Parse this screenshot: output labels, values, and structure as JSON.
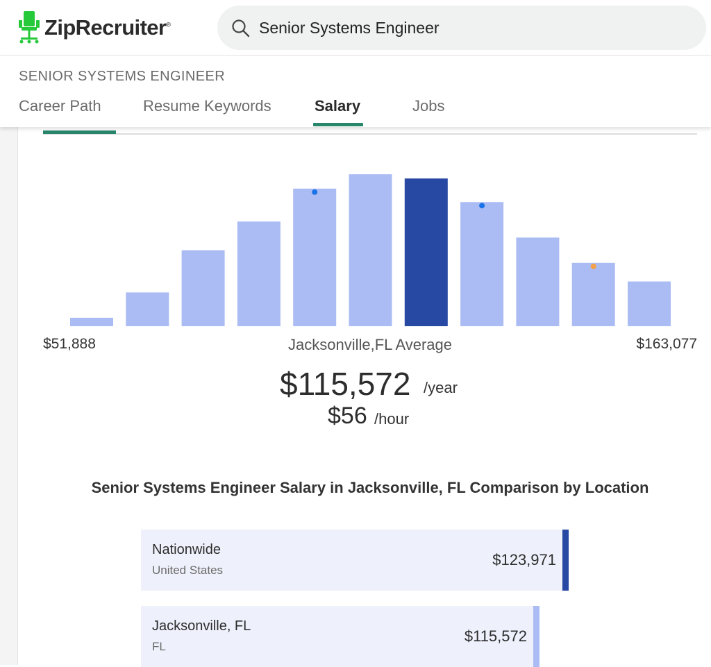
{
  "brand": {
    "name": "ZipRecruiter",
    "mark": "®",
    "chair_color": "#25c93a"
  },
  "search": {
    "value": "Senior Systems Engineer"
  },
  "breadcrumb": "SENIOR SYSTEMS ENGINEER",
  "tabs": [
    {
      "label": "Career Path",
      "active": false
    },
    {
      "label": "Resume Keywords",
      "active": false
    },
    {
      "label": "Salary",
      "active": true
    },
    {
      "label": "Jobs",
      "active": false
    }
  ],
  "colors": {
    "accent": "#28866b",
    "bar": "#aabcf3",
    "bar_highlight": "#2748a3",
    "marker_blue": "#1a73e8",
    "marker_orange": "#f4a14a"
  },
  "chart_data": {
    "type": "bar",
    "bins": 11,
    "values": [
      1,
      4,
      9,
      12.4,
      16.3,
      18,
      17.5,
      14.7,
      10.5,
      7.5,
      5.3
    ],
    "highlight_index": 6,
    "markers": [
      {
        "index": 4,
        "color": "#1a73e8"
      },
      {
        "index": 7,
        "color": "#1a73e8"
      },
      {
        "index": 9,
        "color": "#f4a14a"
      }
    ],
    "ylim": [
      0,
      18.5
    ]
  },
  "salary": {
    "min": "$51,888",
    "max": "$163,077",
    "average_label": "Jacksonville,FL Average",
    "yearly": "$115,572",
    "yearly_unit": "/year",
    "hourly": "$56",
    "hourly_unit": "/hour"
  },
  "comparison": {
    "title": "Senior Systems Engineer Salary in Jacksonville, FL Comparison by Location",
    "locations": [
      {
        "name": "Nationwide",
        "sub": "United States",
        "value": "$123,971",
        "amount": 123971,
        "color": "#2748a3"
      },
      {
        "name": "Jacksonville, FL",
        "sub": "FL",
        "value": "$115,572",
        "amount": 115572,
        "color": "#aabcf3"
      }
    ]
  }
}
